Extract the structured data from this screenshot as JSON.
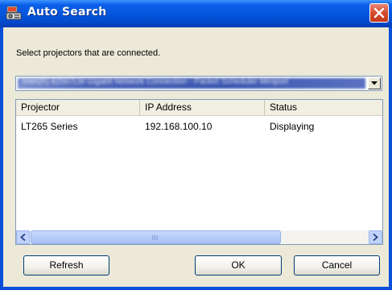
{
  "window": {
    "title": "Auto Search"
  },
  "dialog": {
    "instruction": "Select projectors that are connected.",
    "adapter_value": "Intel(R) 82567LM Gigabit Network Connection - Packet Scheduler Miniport"
  },
  "table": {
    "columns": [
      "Projector",
      "IP Address",
      "Status"
    ],
    "rows": [
      [
        "LT265 Series",
        "192.168.100.10",
        "Displaying"
      ]
    ]
  },
  "buttons": {
    "refresh": "Refresh",
    "ok": "OK",
    "cancel": "Cancel"
  },
  "colors": {
    "titlebar": "#0455dc",
    "face": "#ece9d8",
    "close": "#d54b2c"
  },
  "icons": {
    "app": "projector-icon",
    "close": "close-icon",
    "dropdown": "chevron-down-icon",
    "scroll_left": "arrow-left-icon",
    "scroll_right": "arrow-right-icon"
  }
}
